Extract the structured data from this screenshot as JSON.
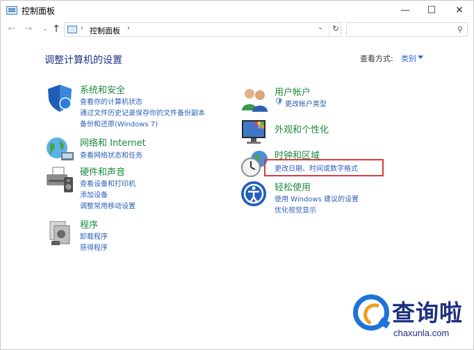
{
  "window": {
    "title": "控制面板",
    "minimize": "—",
    "maximize": "☐",
    "close": "✕"
  },
  "nav": {
    "back": "←",
    "forward": "→",
    "recent": "⌄",
    "up": "↑"
  },
  "address": {
    "separator": "›",
    "crumb": "控制面板",
    "dropdown": "⌄",
    "refresh": "↻"
  },
  "search": {
    "placeholder": "",
    "icon": "⚲"
  },
  "main": {
    "title": "调整计算机的设置",
    "view_by_label": "查看方式:",
    "view_by_value": "类别"
  },
  "categories": {
    "system": {
      "title": "系统和安全",
      "links": [
        "查看你的计算机状态",
        "通过文件历史记录保存你的文件备份副本",
        "备份和还原(Windows 7)"
      ]
    },
    "network": {
      "title": "网络和 Internet",
      "links": [
        "查看网络状态和任务"
      ]
    },
    "hardware": {
      "title": "硬件和声音",
      "links": [
        "查看设备和打印机",
        "添加设备",
        "调整常用移动设置"
      ]
    },
    "programs": {
      "title": "程序",
      "links": [
        "卸载程序",
        "获得程序"
      ]
    },
    "users": {
      "title": "用户帐户",
      "links": [
        "更改帐户类型"
      ]
    },
    "appearance": {
      "title": "外观和个性化",
      "links": []
    },
    "clock": {
      "title": "时钟和区域",
      "links": [
        "更改日期、时间或数字格式"
      ]
    },
    "ease": {
      "title": "轻松使用",
      "links": [
        "使用 Windows 建议的设置",
        "优化视觉显示"
      ]
    }
  },
  "watermark": {
    "text": "查询啦",
    "sub": "chaxunla.com"
  },
  "colors": {
    "category_title": "#1b8a3c",
    "link": "#2b5fb8",
    "page_title": "#1e3287",
    "highlight": "#d63b3b"
  }
}
